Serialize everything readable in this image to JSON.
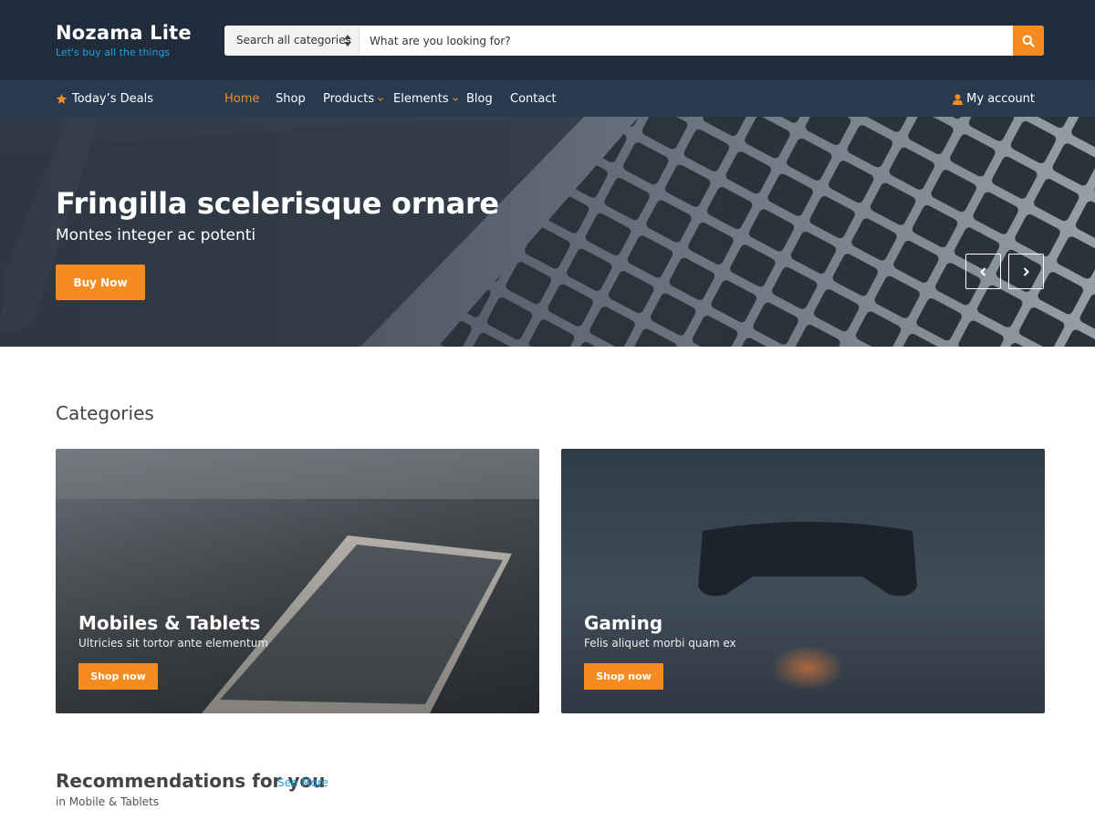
{
  "brand": {
    "title": "Nozama Lite",
    "tagline": "Let's buy all the things"
  },
  "search": {
    "category": "Search all categories",
    "placeholder": "What are you looking for?"
  },
  "nav": {
    "deals": "Today’s Deals",
    "items": [
      {
        "label": "Home",
        "active": true
      },
      {
        "label": "Shop"
      },
      {
        "label": "Products",
        "dropdown": true
      },
      {
        "label": "Elements",
        "dropdown": true
      },
      {
        "label": "Blog"
      },
      {
        "label": "Contact"
      }
    ],
    "account": "My account"
  },
  "hero": {
    "title": "Fringilla scelerisque ornare",
    "subtitle": "Montes integer ac potenti",
    "button": "Buy Now"
  },
  "categories": {
    "title": "Categories",
    "cards": [
      {
        "title": "Mobiles & Tablets",
        "subtitle": "Ultricies sit tortor ante elementum",
        "button": "Shop now"
      },
      {
        "title": "Gaming",
        "subtitle": "Felis aliquet morbi quam ex",
        "button": "Shop now"
      }
    ]
  },
  "recommendations": {
    "title": "Recommendations for you",
    "link": "See More",
    "subtitle": "in Mobile & Tablets"
  },
  "colors": {
    "accent": "#f68b1f",
    "link": "#1fa0dc",
    "header": "#1f2b3a",
    "nav": "#283a50"
  },
  "icons": [
    "sort-icon",
    "search-icon",
    "star-icon",
    "chevron-down-icon",
    "user-icon",
    "chevron-left-icon",
    "chevron-right-icon"
  ]
}
